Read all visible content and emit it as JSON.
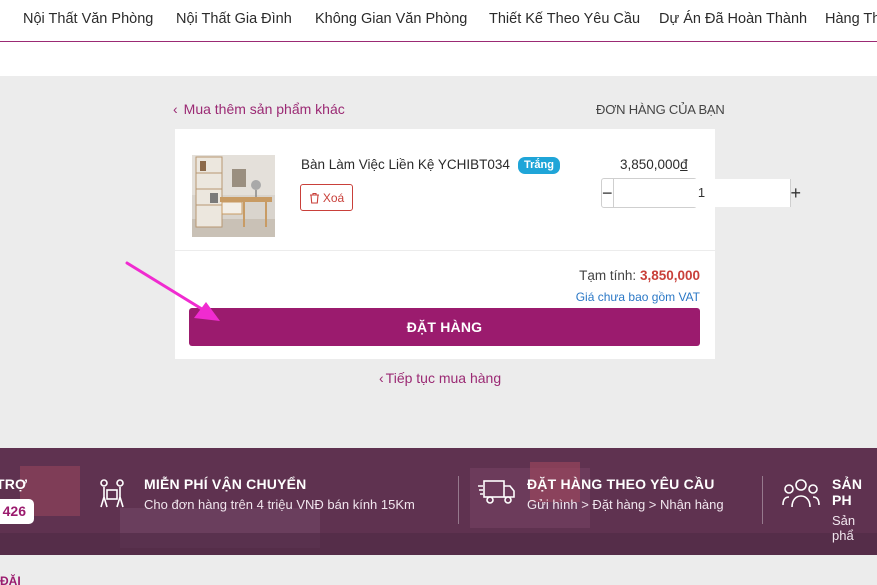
{
  "nav": {
    "items": [
      "Nội Thất Văn Phòng",
      "Nội Thất Gia Đình",
      "Không Gian Văn Phòng",
      "Thiết Kế Theo Yêu Cầu",
      "Dự Án Đã Hoàn Thành",
      "Hàng Th"
    ]
  },
  "cart": {
    "back_link": "Mua thêm sản phẩm khác",
    "order_title": "ĐƠN HÀNG CỦA BẠN",
    "item": {
      "name": "Bàn Làm Việc Liền Kệ YCHIBT034",
      "tag": "Trắng",
      "delete_label": "Xoá",
      "price": "3,850,000",
      "currency": "đ",
      "quantity": "1",
      "minus": "−",
      "plus": "+"
    },
    "subtotal_label": "Tạm tính:",
    "subtotal_value": "3,850,000",
    "vat_note": "Giá chưa bao gồm VAT",
    "order_button": "ĐẶT HÀNG",
    "continue_link": "Tiếp tục mua hàng"
  },
  "banner": {
    "support_title": "TRỢ",
    "support_phone": "426",
    "features": [
      {
        "title": "MIỄN PHÍ VẬN CHUYỂN",
        "subtitle": "Cho đơn hàng trên 4 triệu VNĐ bán kính 15Km",
        "icon": "delivery-people-icon"
      },
      {
        "title": "ĐẶT HÀNG THEO YÊU CẦU",
        "subtitle": "Gửi hình > Đặt hàng > Nhận hàng",
        "icon": "truck-icon"
      },
      {
        "title": "SẢN PH",
        "subtitle": "Sản phẩ",
        "icon": "group-icon"
      }
    ]
  },
  "footer": {
    "partial_text": "ĐĂI"
  },
  "colors": {
    "brand": "#9b1b6e",
    "price_red": "#c9403a",
    "link_blue": "#2b78c6",
    "tag_blue": "#1fa5d8",
    "annotation_arrow": "#f02bd0"
  }
}
